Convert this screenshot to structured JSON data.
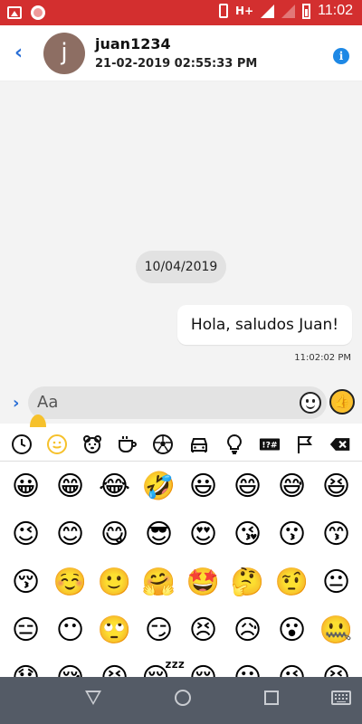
{
  "status_bar": {
    "network": "H+",
    "time": "11:02",
    "icons": [
      "gallery-icon",
      "record-icon",
      "vibrate-icon",
      "signal-icon",
      "battery-icon"
    ],
    "color": "#d32f2f"
  },
  "header": {
    "back_icon": "chevron-left-icon",
    "avatar_letter": "j",
    "username": "juan1234",
    "datetime": "21-02-2019 02:55:33 PM",
    "info_icon": "info-icon",
    "accent": "#2a6fd6"
  },
  "chat": {
    "date_chip": "10/04/2019",
    "messages": [
      {
        "text": "Hola, saludos Juan!",
        "time": "11:02:02 PM"
      }
    ]
  },
  "input": {
    "placeholder": "Aa",
    "expand_icon": "chevron-right-icon",
    "emoji_button_icon": "smiley-icon",
    "like_button_icon": "thumbs-up-icon"
  },
  "emoji_categories": [
    "recent-icon",
    "smileys-icon",
    "animals-icon",
    "food-icon",
    "activity-icon",
    "travel-icon",
    "objects-icon",
    "symbols-icon",
    "flags-icon",
    "backspace-icon"
  ],
  "emoji_categories_symbols_label": "!?#",
  "emoji_rows": [
    [
      "😀",
      "😁",
      "😂",
      "🤣",
      "😃",
      "😄",
      "😅",
      "😆"
    ],
    [
      "😉",
      "😊",
      "😋",
      "😎",
      "😍",
      "😘",
      "😗",
      "😙"
    ],
    [
      "😚",
      "☺️",
      "🙂",
      "🤗",
      "🤩",
      "🤔",
      "🤨",
      "😐"
    ],
    [
      "😑",
      "😶",
      "🙄",
      "😏",
      "😣",
      "😥",
      "😮",
      "🤐"
    ],
    [
      "😯",
      "😪",
      "😫",
      "😴",
      "😌",
      "😛",
      "😜",
      "😝"
    ]
  ],
  "nav_bar": {
    "icons": [
      "back-icon",
      "home-icon",
      "recents-icon",
      "keyboard-icon"
    ]
  }
}
